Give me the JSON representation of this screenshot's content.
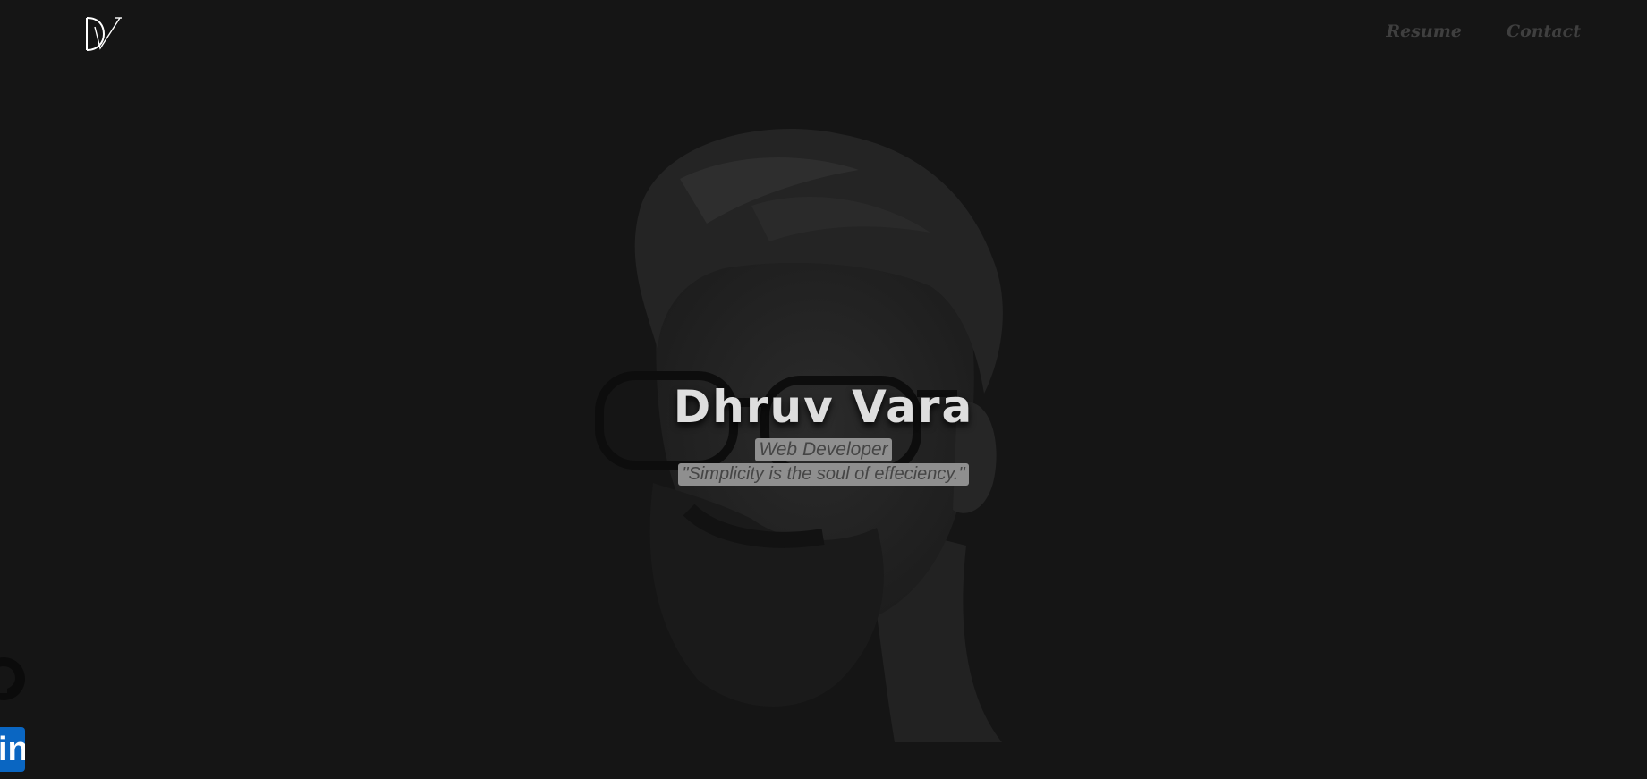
{
  "header": {
    "logo_icon": "dv-monogram-logo",
    "nav": {
      "resume_label": "Resume",
      "contact_label": "Contact"
    }
  },
  "hero": {
    "name": "Dhruv Vara",
    "role": "Web Developer",
    "quote": "\"Simplicity is the soul of effeciency.\"",
    "portrait_icon": "portrait-illustration"
  },
  "social": {
    "github_icon": "github-icon",
    "linkedin_icon": "linkedin-icon",
    "linkedin_glyph": "in"
  },
  "colors": {
    "background": "#151515",
    "nav_text": "#3f3f3f",
    "name_text": "#dedede",
    "tag_background": "#8f8f8f",
    "tag_text": "#454545",
    "linkedin_blue": "#0a66c2"
  }
}
